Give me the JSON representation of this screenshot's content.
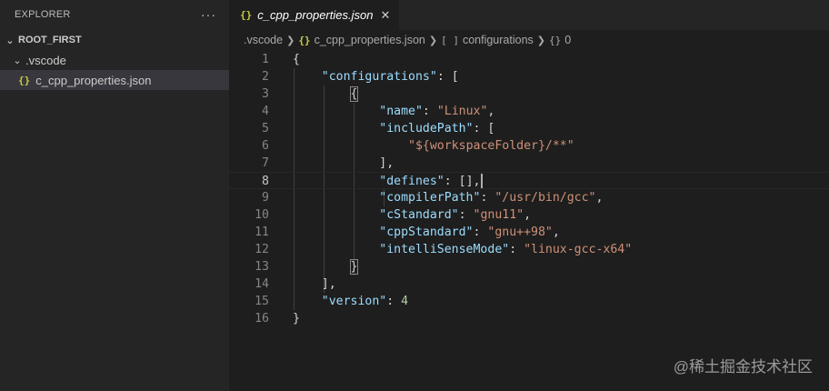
{
  "sidebar": {
    "title": "EXPLORER",
    "more_icon": "···",
    "root": "ROOT_FIRST",
    "folder": ".vscode",
    "file": "c_cpp_properties.json"
  },
  "tab": {
    "label": "c_cpp_properties.json",
    "icon": "{}",
    "close": "✕"
  },
  "breadcrumb": {
    "items": [
      ".vscode",
      "c_cpp_properties.json",
      "configurations",
      "0"
    ],
    "icons": [
      "",
      "{}",
      "[ ]",
      "{}"
    ]
  },
  "editor": {
    "active_line": 8,
    "line_numbers": [
      "1",
      "2",
      "3",
      "4",
      "5",
      "6",
      "7",
      "8",
      "9",
      "10",
      "11",
      "12",
      "13",
      "14",
      "15",
      "16"
    ],
    "code": {
      "configurations_key": "\"configurations\"",
      "name_key": "\"name\"",
      "name_val": "\"Linux\"",
      "includePath_key": "\"includePath\"",
      "includePath_val": "\"${workspaceFolder}/**\"",
      "defines_key": "\"defines\"",
      "compilerPath_key": "\"compilerPath\"",
      "compilerPath_val": "\"/usr/bin/gcc\"",
      "cStandard_key": "\"cStandard\"",
      "cStandard_val": "\"gnu11\"",
      "cppStandard_key": "\"cppStandard\"",
      "cppStandard_val": "\"gnu++98\"",
      "intelliSenseMode_key": "\"intelliSenseMode\"",
      "intelliSenseMode_val": "\"linux-gcc-x64\"",
      "version_key": "\"version\"",
      "version_val": "4"
    }
  },
  "watermark": "@稀土掘金技术社区",
  "colors": {
    "key": "#9cdcfe",
    "string": "#ce9178",
    "number": "#b5cea8",
    "json_icon": "#cbcb41"
  }
}
